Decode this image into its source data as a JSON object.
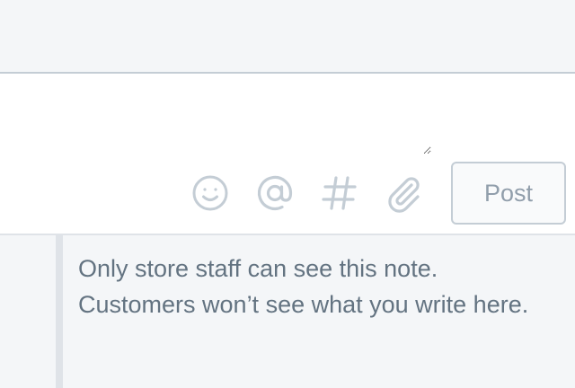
{
  "composer": {
    "input_value": "",
    "post_label": "Post",
    "tools": [
      "emoji-icon",
      "mention-at-icon",
      "hashtag-icon",
      "attachment-paperclip-icon"
    ]
  },
  "note": {
    "text": "Only store staff can see this note. Customers won’t see what you write here."
  },
  "colors": {
    "background": "#f4f6f8",
    "border": "#c4cdd5",
    "icon": "#c4cdd5",
    "text_muted": "#637381",
    "button_text": "#919eab"
  }
}
